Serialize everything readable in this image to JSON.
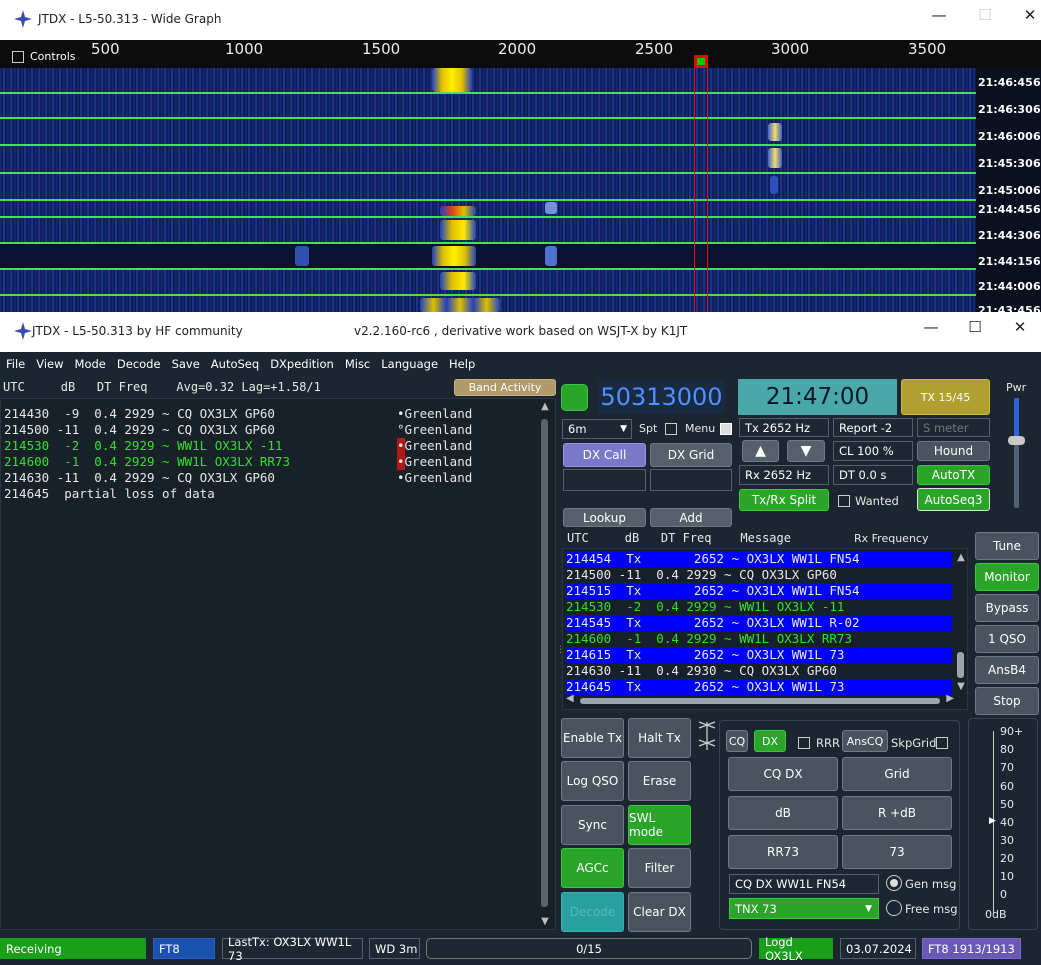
{
  "wg": {
    "title": "JTDX - L5-50.313 - Wide Graph",
    "controls_label": "Controls",
    "ticks": [
      "500",
      "1000",
      "1500",
      "2000",
      "2500",
      "3000",
      "3500"
    ],
    "times": [
      "21:46:45",
      "21:46:30",
      "21:46:00",
      "21:45:30",
      "21:45:00",
      "21:44:45",
      "21:44:30",
      "21:44:15",
      "21:44:00",
      "21:43:45"
    ],
    "edge": "6"
  },
  "main": {
    "title": "JTDX - L5-50.313  by HF community",
    "subtitle": "v2.2.160-rc6 , derivative work based on WSJT-X by K1JT"
  },
  "menu": [
    "File",
    "View",
    "Mode",
    "Decode",
    "Save",
    "AutoSeq",
    "DXpedition",
    "Misc",
    "Language",
    "Help"
  ],
  "band": {
    "header": "UTC     dB   DT Freq    Avg=0.32 Lag=+1.58/1",
    "button": "Band Activity",
    "rows": [
      {
        "text": "214430  -9  0.4 2929 ~ CQ OX3LX GP60",
        "country": "•Greenland",
        "green": false
      },
      {
        "text": "214500 -11  0.4 2929 ~ CQ OX3LX GP60",
        "country": "°Greenland",
        "green": false
      },
      {
        "text": "214530  -2  0.4 2929 ~ WW1L OX3LX -11",
        "country": "•Greenland",
        "green": true
      },
      {
        "text": "214600  -1  0.4 2929 ~ WW1L OX3LX RR73",
        "country": "•Greenland",
        "green": true
      },
      {
        "text": "214630 -11  0.4 2929 ~ CQ OX3LX GP60",
        "country": "•Greenland",
        "green": false
      },
      {
        "text": "214645  partial loss of data",
        "country": "",
        "green": false
      }
    ]
  },
  "freq": "50313000",
  "clock": "21:47:00",
  "tx_period": "TX 15/45",
  "pwr": "Pwr",
  "band_sel": "6m",
  "spt": "Spt",
  "menu_chk": "Menu",
  "tx_hz": "Tx  2652  Hz",
  "rx_hz": "Rx  2652  Hz",
  "report": "Report -2",
  "smeter": "S meter",
  "cl": "CL  100 %",
  "dt": "DT 0.0 s",
  "hound": "Hound",
  "autotx": "AutoTX",
  "autoseq3": "AutoSeq3",
  "dxcall": "DX Call",
  "dxgrid": "DX Grid",
  "txrx_split": "Tx/Rx Split",
  "wanted": "Wanted",
  "lookup": "Lookup",
  "add": "Add",
  "rx": {
    "header": "UTC     dB   DT Freq    Message",
    "rxfreq": "Rx Frequency",
    "rows": [
      {
        "text": "214454  Tx       2652 ~ OX3LX WW1L FN54",
        "kind": "tx"
      },
      {
        "text": "214500 -11  0.4 2929 ~ CQ OX3LX GP60",
        "kind": "n"
      },
      {
        "text": "214515  Tx       2652 ~ OX3LX WW1L FN54",
        "kind": "tx"
      },
      {
        "text": "214530  -2  0.4 2929 ~ WW1L OX3LX -11",
        "kind": "g"
      },
      {
        "text": "214545  Tx       2652 ~ OX3LX WW1L R-02",
        "kind": "tx"
      },
      {
        "text": "214600  -1  0.4 2929 ~ WW1L OX3LX RR73",
        "kind": "g"
      },
      {
        "text": "214615  Tx       2652 ~ OX3LX WW1L 73",
        "kind": "tx"
      },
      {
        "text": "214630 -11  0.4 2930 ~ CQ OX3LX GP60",
        "kind": "n"
      },
      {
        "text": "214645  Tx       2652 ~ OX3LX WW1L 73",
        "kind": "tx"
      }
    ]
  },
  "side": [
    "Tune",
    "Monitor",
    "Bypass",
    "1 QSO",
    "AnsB4",
    "Stop"
  ],
  "left": {
    "enable_tx": "Enable Tx",
    "halt_tx": "Halt Tx",
    "log_qso": "Log QSO",
    "erase": "Erase",
    "sync": "Sync",
    "swl": "SWL mode",
    "agcc": "AGCc",
    "filter": "Filter",
    "decode": "Decode",
    "clear_dx": "Clear DX"
  },
  "msg": {
    "cq": "CQ",
    "dx": "DX",
    "rrr": "RRR",
    "anscq": "AnsCQ",
    "skpgrid": "SkpGrid",
    "cqdx": "CQ DX",
    "grid": "Grid",
    "db": "dB",
    "rdb": "R +dB",
    "rr73": "RR73",
    "s73": "73",
    "genfield": "CQ DX WW1L FN54",
    "gen": "Gen msg",
    "tnx": "TNX 73",
    "free": "Free msg"
  },
  "meter": {
    "labels": [
      "90+",
      "80",
      "70",
      "60",
      "50",
      "40",
      "30",
      "20",
      "10",
      "0"
    ],
    "unit": "0dB"
  },
  "status": {
    "state": "Receiving",
    "mode": "FT8",
    "lasttx": "LastTx: OX3LX WW1L 73",
    "wd": "WD 3m",
    "progress": "0/15",
    "logd": "Logd OX3LX",
    "date": "03.07.2024",
    "count": "FT8  1913/1913"
  }
}
